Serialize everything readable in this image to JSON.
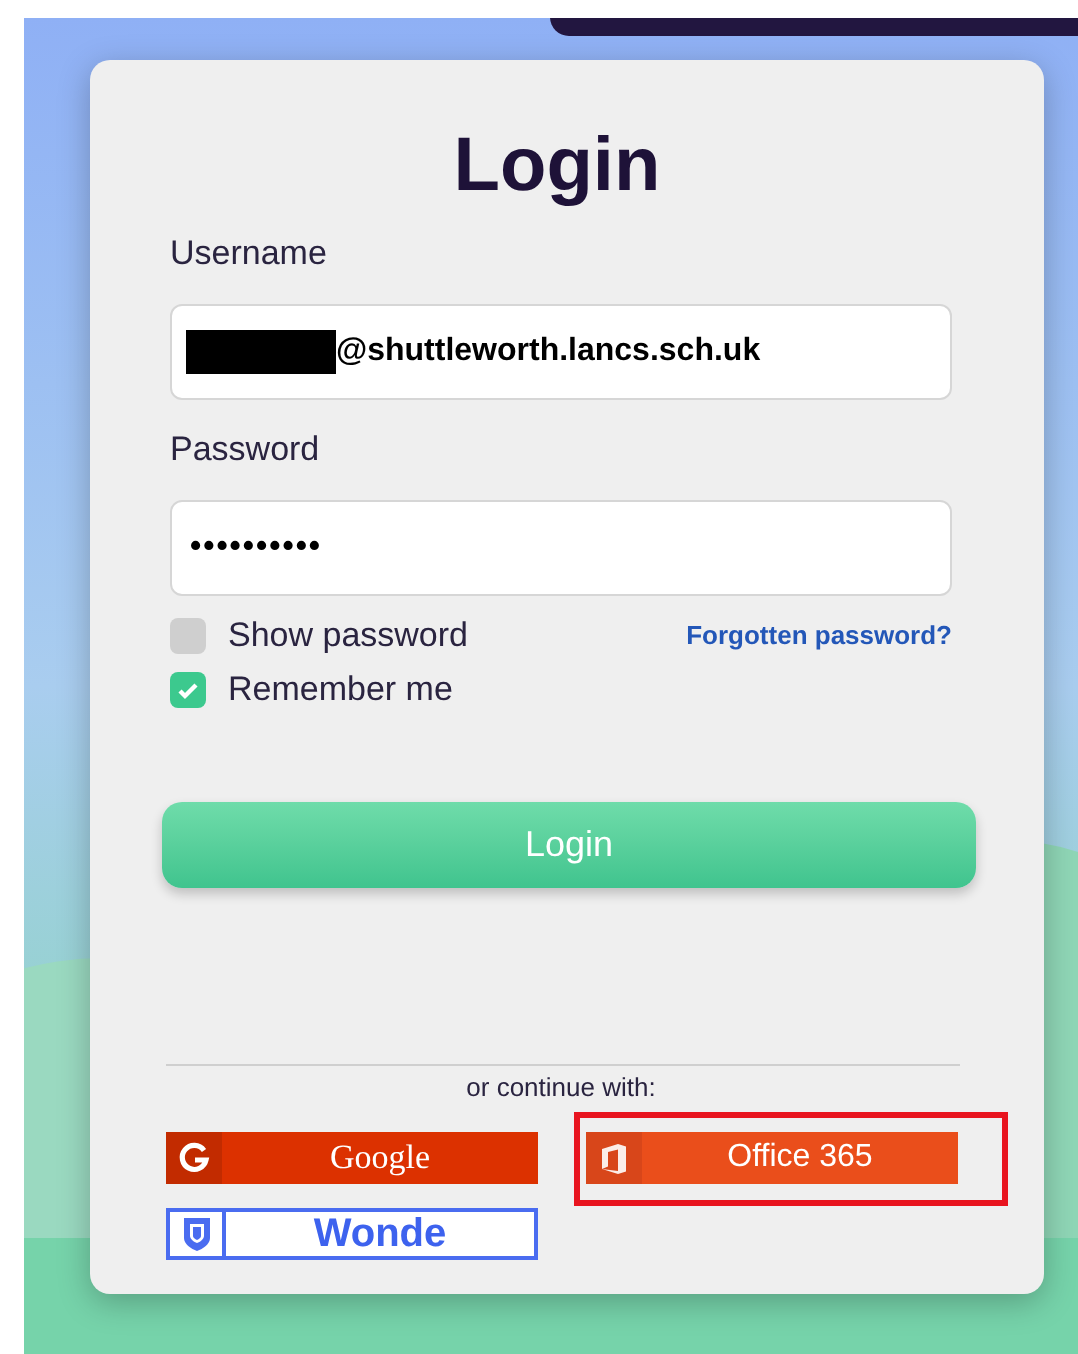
{
  "title": "Login",
  "fields": [
    {
      "label": "Username",
      "value": "@shuttleworth.lancs.sch.uk",
      "kind": "text",
      "redacted": true
    },
    {
      "label": "Password",
      "value": "••••••••••",
      "kind": "password",
      "redacted": false
    }
  ],
  "options": [
    {
      "label": "Show password",
      "checked": false
    },
    {
      "label": "Remember me",
      "checked": true
    }
  ],
  "forgot_link": "Forgotten password?",
  "submit": "Login",
  "divider_text": "or continue with:",
  "providers": [
    {
      "label": "Google",
      "kind": "google",
      "highlighted": false
    },
    {
      "label": "Office 365",
      "kind": "office",
      "highlighted": true
    },
    {
      "label": "Wonde",
      "kind": "wonde",
      "highlighted": false
    }
  ]
}
